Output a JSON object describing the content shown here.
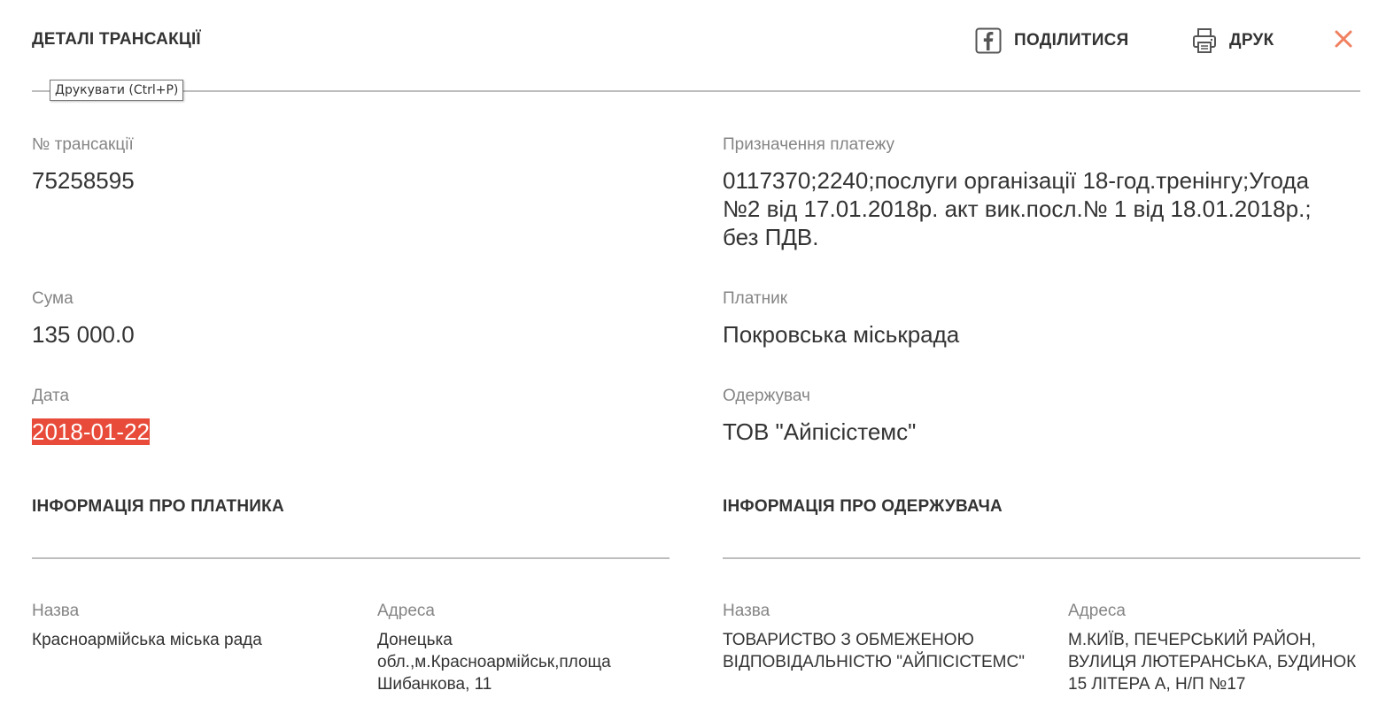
{
  "header": {
    "title": "ДЕТАЛІ ТРАНСАКЦІЇ",
    "share_label": "ПОДІЛИТИСЯ",
    "print_label": "ДРУК",
    "close_label": "✕",
    "tooltip": "Друкувати (Ctrl+P)"
  },
  "transaction": {
    "number_label": "№ трансакції",
    "number_value": "75258595",
    "amount_label": "Сума",
    "amount_value": "135 000.0",
    "date_label": "Дата",
    "date_value": "2018-01-22",
    "purpose_label": "Призначення платежу",
    "purpose_value": "0117370;2240;послуги організації 18-год.тренінгу;Угода №2 від 17.01.2018р. акт вик.посл.№ 1 від 18.01.2018р.; без ПДВ.",
    "payer_label": "Платник",
    "payer_value": "Покровська міськрада",
    "recipient_label": "Одержувач",
    "recipient_value": "ТОВ \"Айпісістемс\""
  },
  "payer_info": {
    "title": "ІНФОРМАЦІЯ ПРО ПЛАТНИКА",
    "name_label": "Назва",
    "name_value": "Красноармійська міська рада",
    "address_label": "Адреса",
    "address_value": "Донецька обл.,м.Красноармійськ,площа Шибанкова, 11"
  },
  "recipient_info": {
    "title": "ІНФОРМАЦІЯ ПРО ОДЕРЖУВАЧА",
    "name_label": "Назва",
    "name_value": "ТОВАРИСТВО З ОБМЕЖЕНОЮ ВІДПОВІДАЛЬНІСТЮ \"АЙПІСІСТЕМС\"",
    "address_label": "Адреса",
    "address_value": "М.КИЇВ, ПЕЧЕРСЬКИЙ РАЙОН, ВУЛИЦЯ ЛЮТЕРАНСЬКА, БУДИНОК 15 ЛІТЕРА А, Н/П №17"
  },
  "icons": {
    "share": "facebook-icon",
    "print": "printer-icon",
    "close": "close-icon"
  },
  "colors": {
    "accent": "#e84b3a",
    "close": "#f08060"
  }
}
